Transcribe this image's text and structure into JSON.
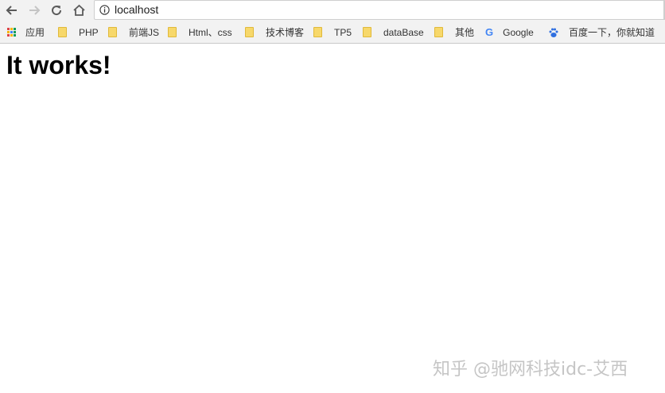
{
  "browser": {
    "address_bar": {
      "url": "localhost"
    }
  },
  "bookmarks": [
    {
      "label": "应用",
      "icon": "apps-grid-icon"
    },
    {
      "label": "PHP",
      "icon": "folder-icon"
    },
    {
      "label": "前端JS",
      "icon": "folder-icon"
    },
    {
      "label": "Html、css",
      "icon": "folder-icon"
    },
    {
      "label": "技术博客",
      "icon": "folder-icon"
    },
    {
      "label": "TP5",
      "icon": "folder-icon"
    },
    {
      "label": "dataBase",
      "icon": "folder-icon"
    },
    {
      "label": "其他",
      "icon": "folder-icon"
    },
    {
      "label": "Google",
      "icon": "google-icon"
    },
    {
      "label": "百度一下，你就知道",
      "icon": "baidu-paw-icon"
    }
  ],
  "page": {
    "heading": "It works!"
  },
  "watermark": {
    "text": "知乎 @驰网科技idc-艾西"
  },
  "colors": {
    "folder": "#f7d86b",
    "toolbar": "#f2f2f2",
    "google_blue": "#4285f4",
    "baidu_blue": "#2f6fe0"
  }
}
